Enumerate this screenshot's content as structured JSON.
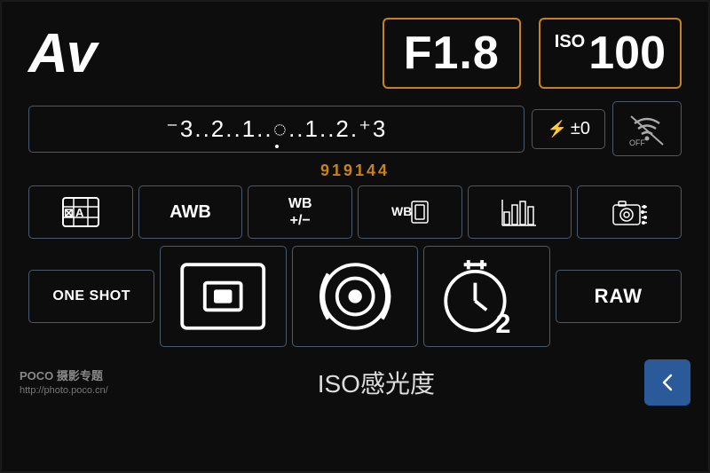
{
  "header": {
    "mode": "Av",
    "aperture": "F1.8",
    "iso_label": "ISO",
    "iso_value": "100"
  },
  "exposure": {
    "scale": "⁻3..2..1..0..1..2.⁺3",
    "flash_label": "⚡±0",
    "wifi_label": "((·))\nOFF"
  },
  "watermark": "919144",
  "icon_row": {
    "metering": "⊠A",
    "awb": "AWB",
    "wb_plus": "WB\n+/−",
    "wb_bracket": "WB",
    "picture_style": "",
    "custom": ""
  },
  "bottom_row": {
    "one_shot": "ONE SHOT",
    "af_point": "",
    "live_view": "",
    "timer": "10s 2",
    "raw": "RAW"
  },
  "footer": {
    "iso_label": "ISO感光度",
    "poco_name": "POCO 摄影专题",
    "poco_url": "http://photo.poco.cn/"
  }
}
